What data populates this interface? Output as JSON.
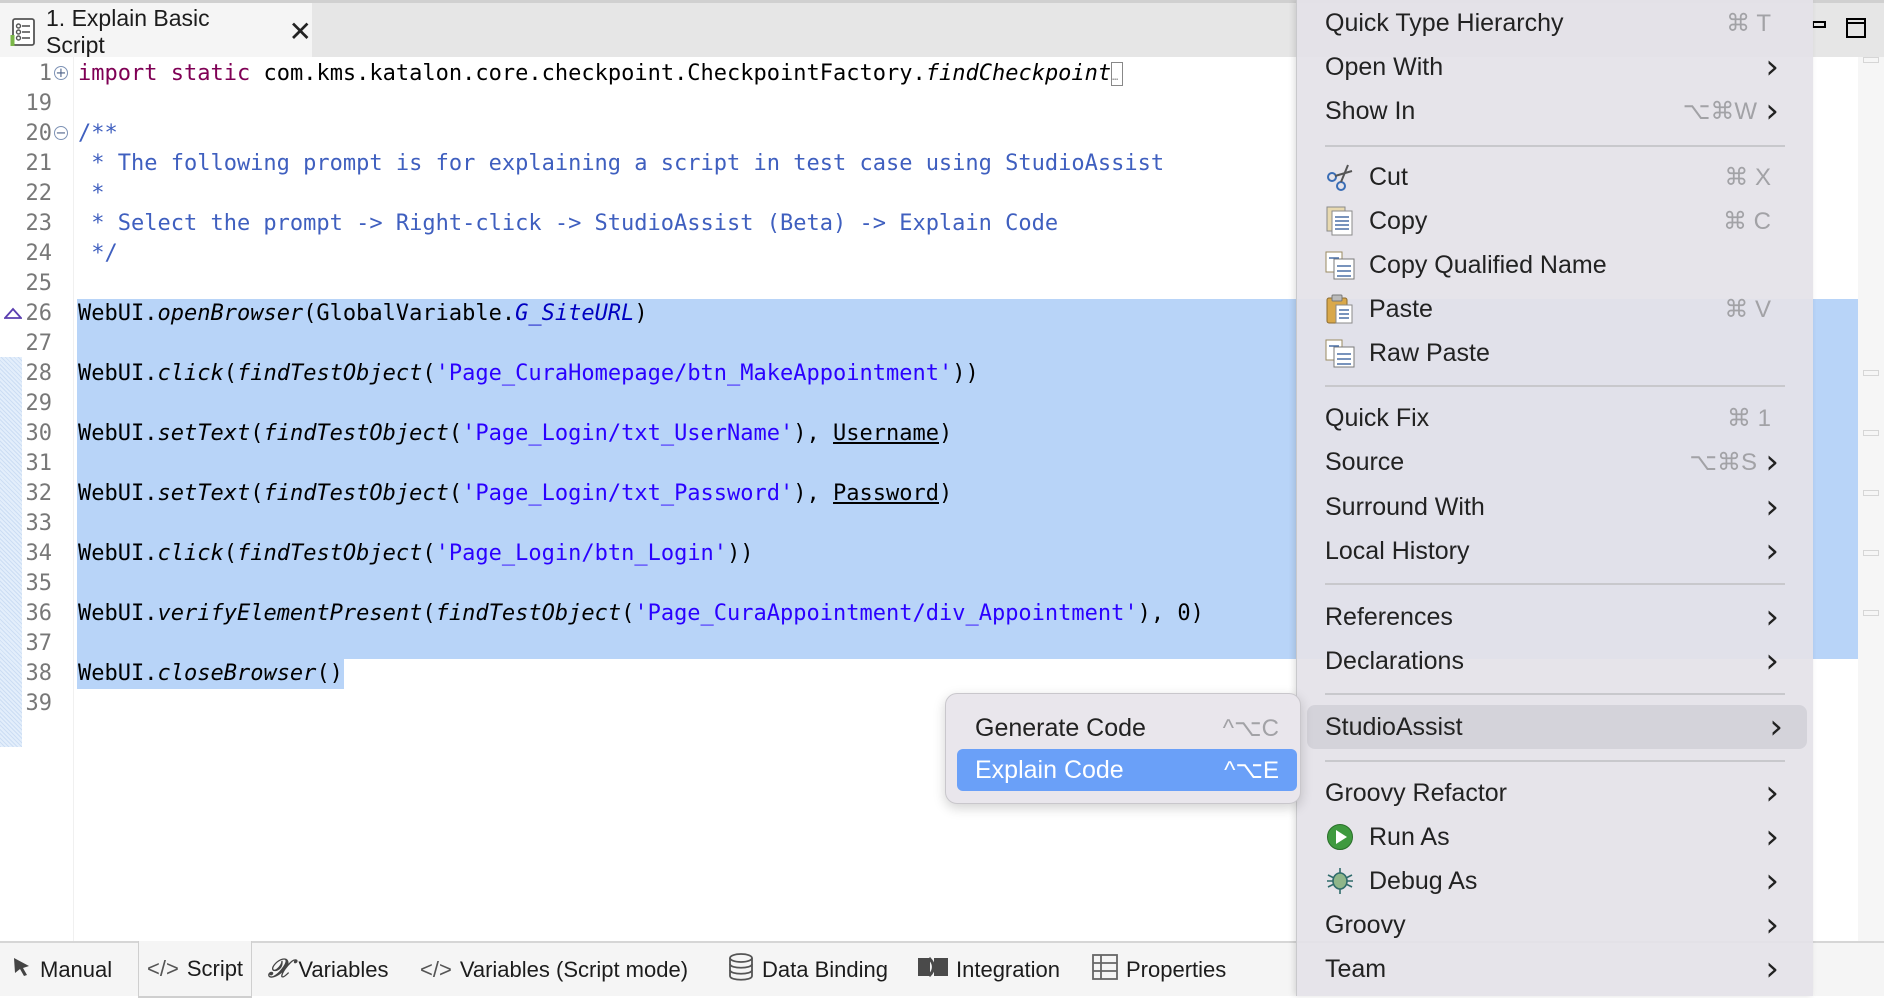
{
  "editor_tab": {
    "title": "1. Explain Basic Script",
    "icon": "test-case-icon",
    "close_icon": "close-icon"
  },
  "window_controls": [
    "minimize-icon",
    "maximize-icon"
  ],
  "code_lines": [
    {
      "num": "1",
      "fold": "+",
      "segments": [
        {
          "t": "import",
          "c": "kw"
        },
        {
          "t": " "
        },
        {
          "t": "static",
          "c": "kw"
        },
        {
          "t": " com.kms.katalon.core.checkpoint.CheckpointFactory."
        },
        {
          "t": "findCheckpoint",
          "c": "it"
        },
        {
          "t": "…",
          "c": "collapsed"
        }
      ]
    },
    {
      "num": "19",
      "segments": []
    },
    {
      "num": "20",
      "fold": "-",
      "segments": [
        {
          "t": "/**",
          "c": "cm"
        }
      ]
    },
    {
      "num": "21",
      "segments": [
        {
          "t": " * The following prompt is for explaining a script in test case using StudioAssist",
          "c": "cm"
        }
      ]
    },
    {
      "num": "22",
      "segments": [
        {
          "t": " *",
          "c": "cm"
        }
      ]
    },
    {
      "num": "23",
      "segments": [
        {
          "t": " * Select the prompt -> Right-click -> StudioAssist (Beta) -> Explain Code",
          "c": "cm"
        }
      ]
    },
    {
      "num": "24",
      "segments": [
        {
          "t": " */",
          "c": "cm"
        }
      ]
    },
    {
      "num": "25",
      "segments": []
    },
    {
      "num": "26",
      "selected": true,
      "segments": [
        {
          "t": "WebUI."
        },
        {
          "t": "openBrowser",
          "c": "it"
        },
        {
          "t": "(GlobalVariable."
        },
        {
          "t": "G_SiteURL",
          "c": "gv"
        },
        {
          "t": ")"
        }
      ]
    },
    {
      "num": "27",
      "selected": true,
      "segments": []
    },
    {
      "num": "28",
      "selected": true,
      "segments": [
        {
          "t": "WebUI."
        },
        {
          "t": "click",
          "c": "it"
        },
        {
          "t": "("
        },
        {
          "t": "findTestObject",
          "c": "it"
        },
        {
          "t": "("
        },
        {
          "t": "'Page_CuraHomepage/btn_MakeAppointment'",
          "c": "str"
        },
        {
          "t": "))"
        }
      ]
    },
    {
      "num": "29",
      "selected": true,
      "segments": []
    },
    {
      "num": "30",
      "selected": true,
      "segments": [
        {
          "t": "WebUI."
        },
        {
          "t": "setText",
          "c": "it"
        },
        {
          "t": "("
        },
        {
          "t": "findTestObject",
          "c": "it"
        },
        {
          "t": "("
        },
        {
          "t": "'Page_Login/txt_UserName'",
          "c": "str"
        },
        {
          "t": "), "
        },
        {
          "t": "Username",
          "c": "ul"
        },
        {
          "t": ")"
        }
      ]
    },
    {
      "num": "31",
      "selected": true,
      "segments": []
    },
    {
      "num": "32",
      "selected": true,
      "segments": [
        {
          "t": "WebUI."
        },
        {
          "t": "setText",
          "c": "it"
        },
        {
          "t": "("
        },
        {
          "t": "findTestObject",
          "c": "it"
        },
        {
          "t": "("
        },
        {
          "t": "'Page_Login/txt_Password'",
          "c": "str"
        },
        {
          "t": "), "
        },
        {
          "t": "Password",
          "c": "ul"
        },
        {
          "t": ")"
        }
      ]
    },
    {
      "num": "33",
      "selected": true,
      "segments": []
    },
    {
      "num": "34",
      "selected": true,
      "segments": [
        {
          "t": "WebUI."
        },
        {
          "t": "click",
          "c": "it"
        },
        {
          "t": "("
        },
        {
          "t": "findTestObject",
          "c": "it"
        },
        {
          "t": "("
        },
        {
          "t": "'Page_Login/btn_Login'",
          "c": "str"
        },
        {
          "t": "))"
        }
      ]
    },
    {
      "num": "35",
      "selected": true,
      "segments": []
    },
    {
      "num": "36",
      "selected": true,
      "segments": [
        {
          "t": "WebUI."
        },
        {
          "t": "verifyElementPresent",
          "c": "it"
        },
        {
          "t": "("
        },
        {
          "t": "findTestObject",
          "c": "it"
        },
        {
          "t": "("
        },
        {
          "t": "'Page_CuraAppointment/div_Appointment'",
          "c": "str"
        },
        {
          "t": "), 0)"
        }
      ]
    },
    {
      "num": "37",
      "selected": true,
      "segments": []
    },
    {
      "num": "38",
      "selected": "partial",
      "segments": [
        {
          "t": "WebUI."
        },
        {
          "t": "closeBrowser",
          "c": "it"
        },
        {
          "t": "()"
        }
      ]
    },
    {
      "num": "39",
      "segments": []
    }
  ],
  "bottom_tabs": [
    {
      "label": "Manual",
      "icon": "cursor-arrow-icon",
      "active": false
    },
    {
      "label": "Script",
      "icon": "code-icon",
      "active": true
    },
    {
      "label": "Variables",
      "icon": "variable-x-icon",
      "active": false
    },
    {
      "label": "Variables (Script mode)",
      "icon": "code-icon",
      "active": false
    },
    {
      "label": "Data Binding",
      "icon": "database-icon",
      "active": false
    },
    {
      "label": "Integration",
      "icon": "integration-icon",
      "active": false
    },
    {
      "label": "Properties",
      "icon": "table-icon",
      "active": false
    }
  ],
  "context_menu": {
    "items": [
      {
        "label": "Quick Type Hierarchy",
        "shortcut": "⌘ T"
      },
      {
        "label": "Open With",
        "submenu": true
      },
      {
        "label": "Show In",
        "shortcut": "⌥⌘W",
        "submenu": true
      },
      {
        "separator": true
      },
      {
        "label": "Cut",
        "shortcut": "⌘ X",
        "icon": "scissors-icon"
      },
      {
        "label": "Copy",
        "shortcut": "⌘ C",
        "icon": "copy-icon"
      },
      {
        "label": "Copy Qualified Name",
        "icon": "copy-qualified-name-icon"
      },
      {
        "label": "Paste",
        "shortcut": "⌘ V",
        "icon": "paste-icon"
      },
      {
        "label": "Raw Paste",
        "icon": "raw-paste-icon"
      },
      {
        "separator": true
      },
      {
        "label": "Quick Fix",
        "shortcut": "⌘ 1"
      },
      {
        "label": "Source",
        "shortcut": "⌥⌘S",
        "submenu": true
      },
      {
        "label": "Surround With",
        "submenu": true
      },
      {
        "label": "Local History",
        "submenu": true
      },
      {
        "separator": true
      },
      {
        "label": "References",
        "submenu": true
      },
      {
        "label": "Declarations",
        "submenu": true
      },
      {
        "separator": true
      },
      {
        "label": "StudioAssist",
        "submenu": true,
        "hover": true
      },
      {
        "separator": true
      },
      {
        "label": "Groovy Refactor",
        "submenu": true
      },
      {
        "label": "Run As",
        "submenu": true,
        "icon": "run-icon"
      },
      {
        "label": "Debug As",
        "submenu": true,
        "icon": "bug-icon"
      },
      {
        "label": "Groovy",
        "submenu": true
      },
      {
        "label": "Team",
        "submenu": true
      }
    ]
  },
  "studioassist_submenu": {
    "items": [
      {
        "label": "Generate Code",
        "shortcut": "^⌥C",
        "active": false
      },
      {
        "label": "Explain Code",
        "shortcut": "^⌥E",
        "active": true
      }
    ]
  },
  "colors": {
    "selection": "#b8d4f8",
    "submenu_active": "#6aa0f8",
    "keyword": "#7f0055",
    "comment": "#3f5fbf",
    "string": "#2a00ff"
  }
}
